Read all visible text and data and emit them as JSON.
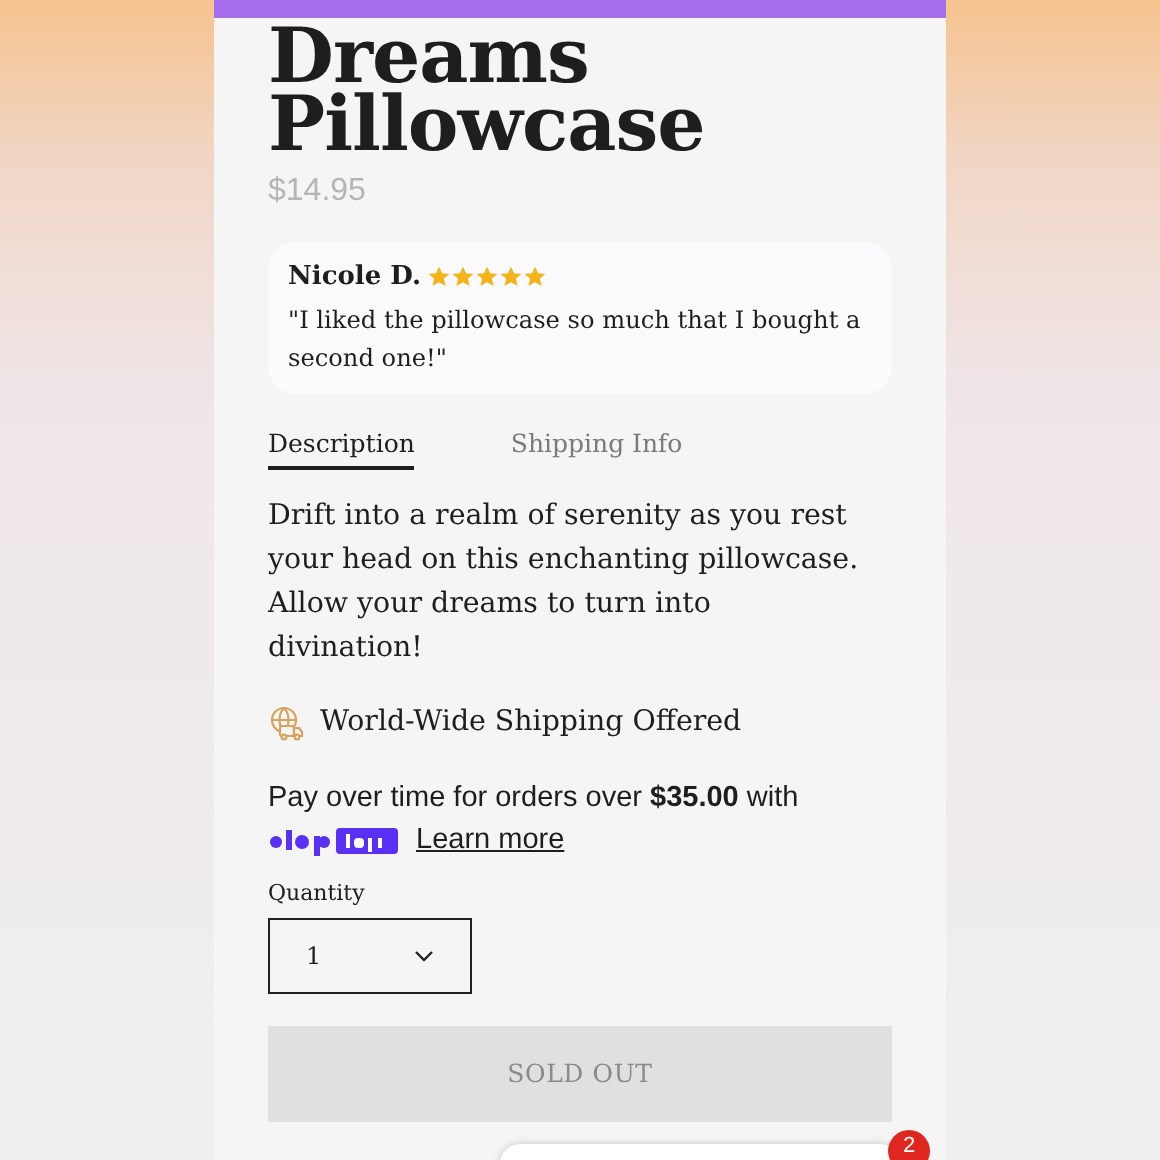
{
  "product": {
    "title": "Dreams Pillowcase",
    "price": "$14.95"
  },
  "review": {
    "author": "Nicole D.",
    "stars": 5,
    "text": "\"I liked the pillowcase so much that I bought a second one!\""
  },
  "tabs": [
    {
      "label": "Description",
      "selected": true
    },
    {
      "label": "Shipping Info",
      "selected": false
    }
  ],
  "description": "Drift into a realm of serenity as you rest your head on this enchanting pillowcase. Allow your dreams to turn into divination!",
  "shipping_note": "World-Wide Shipping Offered",
  "installments": {
    "text": "Pay over time for orders over **$35.00** with",
    "link": "Learn more"
  },
  "quantity": {
    "label": "Quantity",
    "value": "1"
  },
  "buy_button": {
    "label": "SOLD OUT",
    "disabled": true
  },
  "chat_badge": "2"
}
